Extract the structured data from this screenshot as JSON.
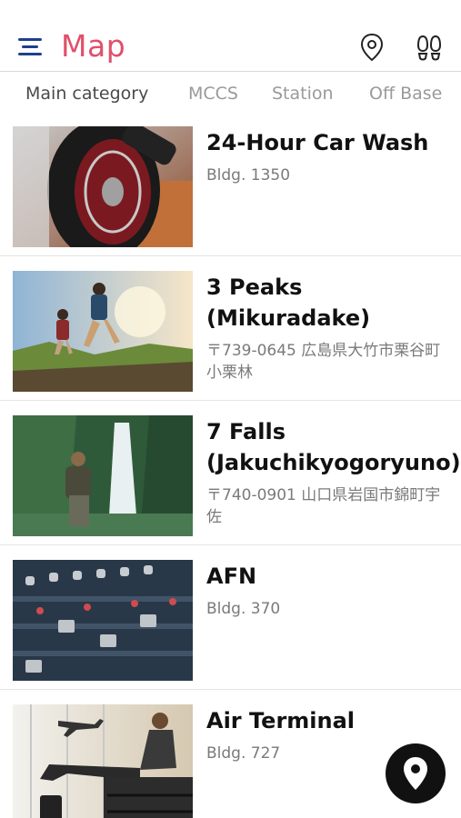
{
  "header": {
    "title": "Map",
    "icons": [
      "menu-icon",
      "location-pin-icon",
      "footsteps-icon"
    ],
    "title_color": "#e0506a",
    "menu_color": "#1f3f8f"
  },
  "tabs": [
    {
      "label": "Main category",
      "active": true
    },
    {
      "label": "MCCS",
      "active": false
    },
    {
      "label": "Station",
      "active": false
    },
    {
      "label": "Off Base",
      "active": false
    }
  ],
  "items": [
    {
      "name": "24-Hour Car Wash",
      "sub": "Bldg. 1350",
      "image": "car-wheel-wash-photo"
    },
    {
      "name": "3 Peaks (Mikuradake)",
      "sub": "〒739-0645 広島県大竹市栗谷町小栗林",
      "image": "hikers-photo"
    },
    {
      "name": "7 Falls (Jakuchikyogoryuno)",
      "sub": "〒740-0901 山口県岩国市錦町宇佐",
      "image": "waterfall-photo"
    },
    {
      "name": "AFN",
      "sub": "Bldg. 370",
      "image": "mixing-console-photo"
    },
    {
      "name": "Air Terminal",
      "sub": "Bldg. 727",
      "image": "airport-terminal-photo"
    }
  ],
  "fab": {
    "icon": "location-pin-icon",
    "color": "#111111"
  }
}
